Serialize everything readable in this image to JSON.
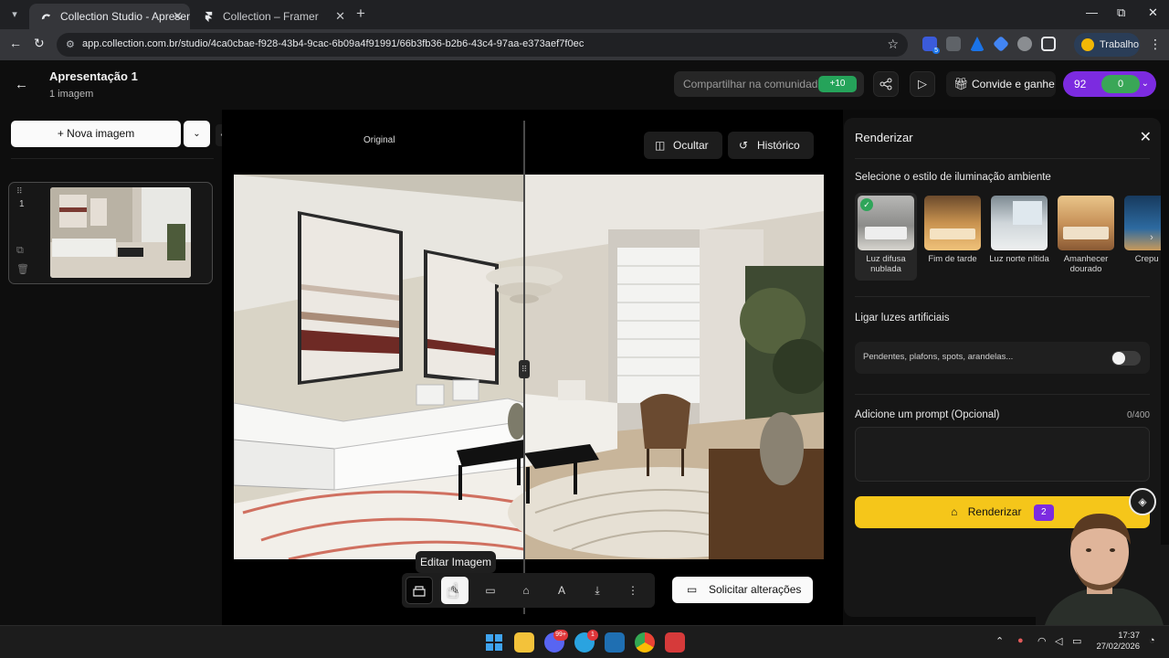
{
  "browser": {
    "tabs": [
      {
        "title": "Collection Studio - Apresentação",
        "active": true
      },
      {
        "title": "Collection – Framer",
        "active": false
      }
    ],
    "url": "app.collection.com.br/studio/4ca0cbae-f928-43b4-9cac-6b09a4f91991/66b3fb36-b2b6-43c4-97aa-e373aef7f0ec",
    "profile_label": "Trabalho",
    "ext_badge": "5"
  },
  "header": {
    "title": "Apresentação 1",
    "subtitle": "1 imagem",
    "share_community": "Compartilhar na comunidade",
    "share_bonus": "+10",
    "invite_label": "Convide e ganhe",
    "credits_a": "92",
    "credits_b": "0"
  },
  "sidebar": {
    "new_image": "Nova imagem",
    "thumb_index": "1"
  },
  "canvas": {
    "original_label": "Original",
    "hide_label": "Ocultar",
    "history_label": "Histórico",
    "tooltip": "Editar Imagem",
    "request_changes": "Solicitar alterações"
  },
  "render_panel": {
    "title": "Renderizar",
    "ambient_heading": "Selecione o estilo de iluminação ambiente",
    "styles": [
      {
        "label": "Luz difusa nublada",
        "selected": true
      },
      {
        "label": "Fim de tarde",
        "selected": false
      },
      {
        "label": "Luz norte nítida",
        "selected": false
      },
      {
        "label": "Amanhecer dourado",
        "selected": false
      },
      {
        "label": "Crepu az",
        "selected": false
      }
    ],
    "artificial_heading": "Ligar luzes artificiais",
    "artificial_placeholder": "Pendentes, plafons, spots, arandelas...",
    "artificial_on": false,
    "prompt_heading": "Adicione um prompt (Opcional)",
    "prompt_counter": "0/400",
    "render_button": "Renderizar",
    "render_cost": "2"
  },
  "taskbar": {
    "discord_badge": "99+",
    "telegram_badge": "1",
    "time": "17:37",
    "date": "27/02/2026"
  },
  "colors": {
    "accent_yellow": "#f5c61a",
    "accent_purple": "#7c2be0",
    "accent_green": "#2fa55a"
  }
}
